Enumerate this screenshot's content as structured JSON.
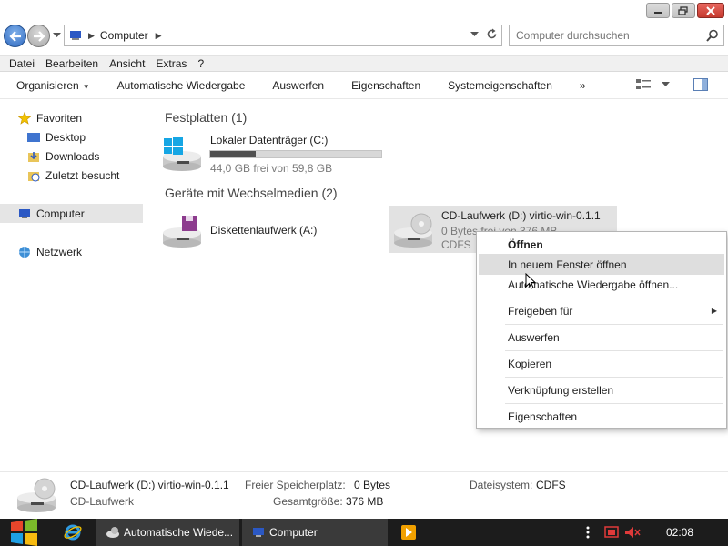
{
  "address": {
    "location": "Computer"
  },
  "search": {
    "placeholder": "Computer durchsuchen"
  },
  "menubar": [
    "Datei",
    "Bearbeiten",
    "Ansicht",
    "Extras",
    "?"
  ],
  "commands": [
    "Organisieren",
    "Automatische Wiedergabe",
    "Auswerfen",
    "Eigenschaften",
    "Systemeigenschaften",
    "»"
  ],
  "nav": {
    "favorites": "Favoriten",
    "desktop": "Desktop",
    "downloads": "Downloads",
    "recent": "Zuletzt besucht",
    "computer": "Computer",
    "network": "Netzwerk"
  },
  "groups": {
    "harddisks": "Festplatten (1)",
    "removable": "Geräte mit Wechselmedien (2)"
  },
  "drives": {
    "c": {
      "title": "Lokaler Datenträger (C:)",
      "free": "44,0 GB frei von 59,8 GB",
      "used_fraction": 0.264
    },
    "a": {
      "title": "Diskettenlaufwerk (A:)"
    },
    "d": {
      "title": "CD-Laufwerk (D:) virtio-win-0.1.1",
      "free": "0 Bytes frei von 376 MB",
      "fs": "CDFS"
    }
  },
  "context_menu": {
    "open": "Öffnen",
    "open_new_window": "In neuem Fenster öffnen",
    "autoplay": "Automatische Wiedergabe öffnen...",
    "share": "Freigeben für",
    "eject": "Auswerfen",
    "copy": "Kopieren",
    "shortcut": "Verknüpfung erstellen",
    "properties": "Eigenschaften"
  },
  "details": {
    "name": "CD-Laufwerk (D:) virtio-win-0.1.1",
    "type": "CD-Laufwerk",
    "free_label": "Freier Speicherplatz:",
    "free_value": "0 Bytes",
    "total_label": "Gesamtgröße:",
    "total_value": "376 MB",
    "fs_label": "Dateisystem:",
    "fs_value": "CDFS"
  },
  "taskbar": {
    "autoplay": "Automatische Wiede...",
    "computer": "Computer",
    "clock": "02:08"
  },
  "colors": {
    "accent": "#2f69c0",
    "close": "#c5392e",
    "taskbar": "#1c1c1c"
  }
}
